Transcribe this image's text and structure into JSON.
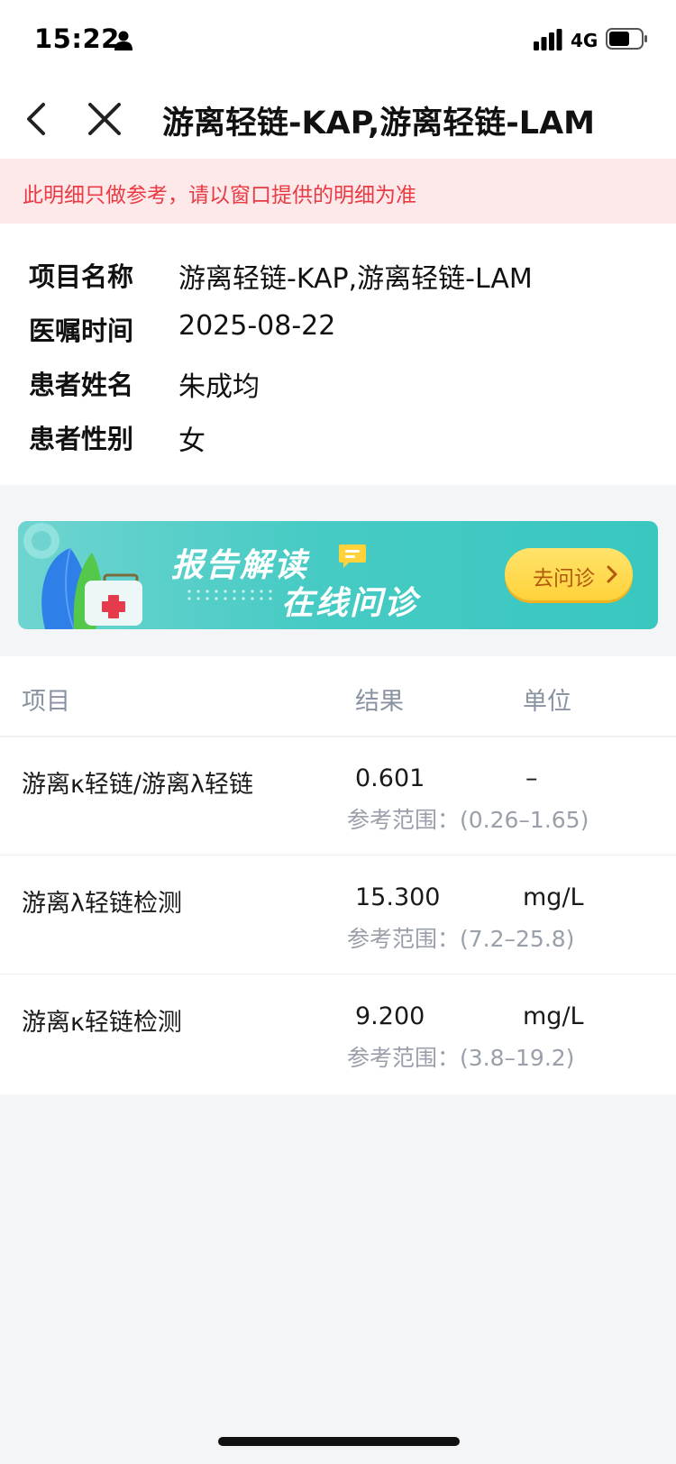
{
  "status": {
    "time": "15:22",
    "network": "4G"
  },
  "nav": {
    "title": "游离轻链-KAP,游离轻链-LAM"
  },
  "notice": {
    "text": "此明细只做参考，请以窗口提供的明细为准"
  },
  "info": {
    "rows": [
      {
        "label": "项目名称",
        "value": "游离轻链-KAP,游离轻链-LAM"
      },
      {
        "label": "医嘱时间",
        "value": "2025-08-22"
      },
      {
        "label": "患者姓名",
        "value": "朱成均"
      },
      {
        "label": "患者性别",
        "value": "女"
      }
    ]
  },
  "banner": {
    "title": "报告解读",
    "subtitle": "在线问诊",
    "button_label": "去问诊"
  },
  "table": {
    "headers": {
      "item": "项目",
      "result": "结果",
      "unit": "单位"
    },
    "rows": [
      {
        "name": "游离κ轻链/游离λ轻链",
        "result": "0.601",
        "unit": "–",
        "range": "参考范围：(0.26–1.65)"
      },
      {
        "name": "游离λ轻链检测",
        "result": "15.300",
        "unit": "mg/L",
        "range": "参考范围：(7.2–25.8)"
      },
      {
        "name": "游离κ轻链检测",
        "result": "9.200",
        "unit": "mg/L",
        "range": "参考范围：(3.8–19.2)"
      }
    ]
  },
  "colors": {
    "notice_bg": "#fde8ea",
    "notice_text": "#ea3a43",
    "banner_teal": "#3fc9c2",
    "button_yellow": "#ffd23a"
  },
  "icons": [
    "person-icon",
    "signal-icon",
    "battery-icon",
    "back-icon",
    "close-icon",
    "chat-icon",
    "chevron-right-icon",
    "medical-kit-icon"
  ]
}
